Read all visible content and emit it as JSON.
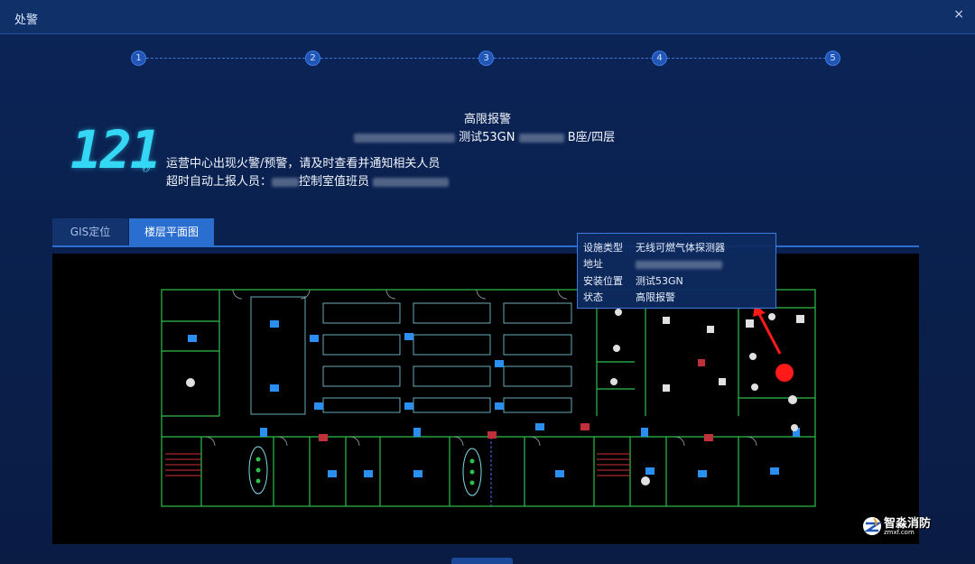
{
  "window": {
    "title": "处警",
    "close_label": "×"
  },
  "stepper": {
    "steps": [
      "1",
      "2",
      "3",
      "4",
      "5"
    ]
  },
  "alarm": {
    "status_title": "高限报警",
    "location_text": "测试53GN",
    "location_suffix": "B座/四层",
    "countdown_value": "121",
    "countdown_unit": "秒",
    "message_line1": "运营中心出现火警/预警，请及时查看并通知相关人员",
    "message_line2_prefix": "超时自动上报人员：",
    "message_line2_role": "控制室值班员"
  },
  "tabs": [
    {
      "label": "GIS定位",
      "active": false
    },
    {
      "label": "楼层平面图",
      "active": true
    }
  ],
  "device_popup": {
    "rows": [
      {
        "key": "设施类型",
        "value": "无线可燃气体探测器"
      },
      {
        "key": "地址",
        "value": ""
      },
      {
        "key": "安装位置",
        "value": "测试53GN"
      },
      {
        "key": "状态",
        "value": "高限报警"
      }
    ]
  },
  "watermark": {
    "name": "智淼消防",
    "sub": "zmxf.com"
  },
  "colors": {
    "accent": "#2a6fd0",
    "timer": "#35d8f4",
    "alarm_marker": "#ff1a1a",
    "plan_wall": "#2ec04a"
  }
}
